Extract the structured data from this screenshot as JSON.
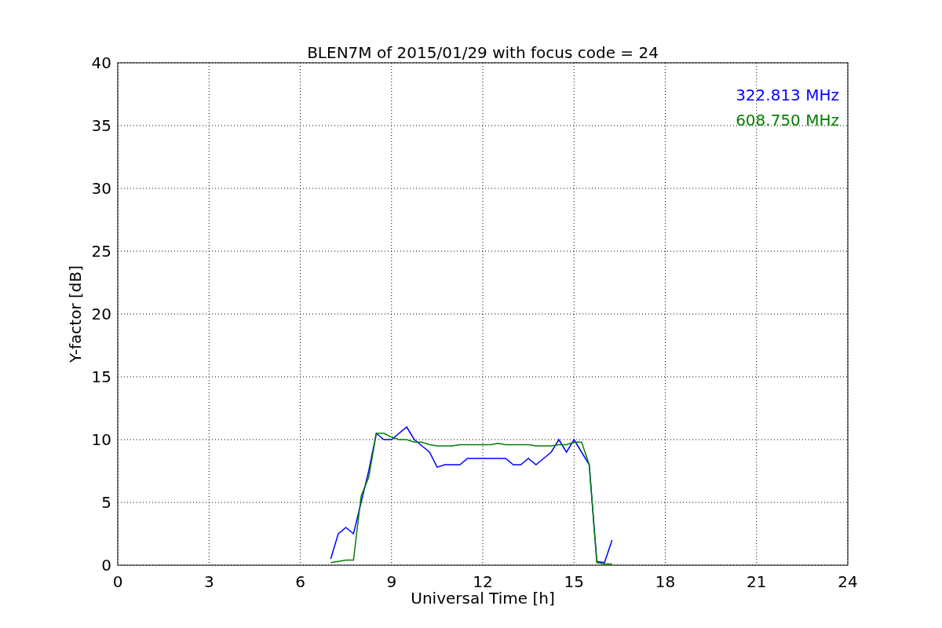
{
  "chart_data": {
    "type": "line",
    "title": "BLEN7M of 2015/01/29 with focus code = 24",
    "xlabel": "Universal Time [h]",
    "ylabel": "Y-factor [dB]",
    "x": [
      7,
      7.25,
      7.5,
      7.75,
      8,
      8.25,
      8.5,
      8.75,
      9,
      9.25,
      9.5,
      9.75,
      10,
      10.25,
      10.5,
      10.75,
      11,
      11.25,
      11.5,
      11.75,
      12,
      12.25,
      12.5,
      12.75,
      13,
      13.25,
      13.5,
      13.75,
      14,
      14.25,
      14.5,
      14.75,
      15,
      15.25,
      15.5,
      15.75,
      16,
      16.25
    ],
    "series": [
      {
        "name": "322.813 MHz",
        "color": "#0000ff",
        "values": [
          0.5,
          2.5,
          3,
          2.5,
          5,
          7.5,
          10.5,
          10,
          10,
          10.5,
          11,
          10,
          9.5,
          9,
          7.8,
          8,
          8,
          8,
          8.5,
          8.5,
          8.5,
          8.5,
          8.5,
          8.5,
          8,
          8,
          8.5,
          8,
          8.5,
          9,
          10,
          9,
          10,
          9,
          8,
          0.3,
          0.2,
          2
        ]
      },
      {
        "name": "608.750 MHz",
        "color": "#008000",
        "values": [
          0.2,
          0.3,
          0.4,
          0.4,
          5.5,
          7,
          10.5,
          10.5,
          10.2,
          10,
          10,
          9.8,
          9.8,
          9.6,
          9.5,
          9.5,
          9.5,
          9.6,
          9.6,
          9.6,
          9.6,
          9.6,
          9.7,
          9.6,
          9.6,
          9.6,
          9.6,
          9.5,
          9.5,
          9.5,
          9.6,
          9.6,
          9.8,
          9.8,
          8,
          0.2,
          0.1,
          0.1
        ]
      }
    ],
    "xlim": [
      0,
      24
    ],
    "ylim": [
      0,
      40
    ],
    "xticks": [
      0,
      3,
      6,
      9,
      12,
      15,
      18,
      21,
      24
    ],
    "yticks": [
      0,
      5,
      10,
      15,
      20,
      25,
      30,
      35,
      40
    ],
    "grid": true
  }
}
